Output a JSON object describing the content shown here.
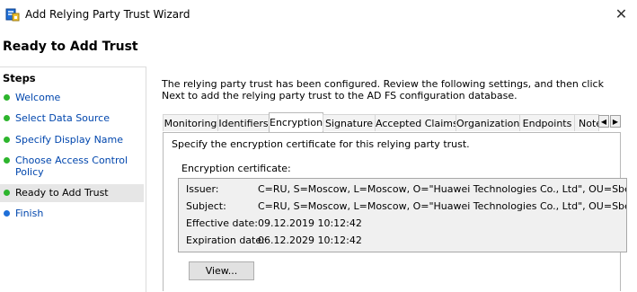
{
  "window": {
    "title": "Add Relying Party Trust Wizard",
    "close_glyph": "✕"
  },
  "page_title": "Ready to Add Trust",
  "steps": {
    "heading": "Steps",
    "items": [
      {
        "label": "Welcome",
        "status": "complete"
      },
      {
        "label": "Select Data Source",
        "status": "complete"
      },
      {
        "label": "Specify Display Name",
        "status": "complete"
      },
      {
        "label": "Choose Access Control\nPolicy",
        "status": "complete"
      },
      {
        "label": "Ready to Add Trust",
        "status": "current"
      },
      {
        "label": "Finish",
        "status": "pending"
      }
    ]
  },
  "main": {
    "description": "The relying party trust has been configured. Review the following settings, and then click Next to add the relying party trust to the AD FS configuration database."
  },
  "tabs": [
    {
      "label": "Monitoring"
    },
    {
      "label": "Identifiers"
    },
    {
      "label": "Encryption",
      "active": true
    },
    {
      "label": "Signature"
    },
    {
      "label": "Accepted Claims"
    },
    {
      "label": "Organization"
    },
    {
      "label": "Endpoints"
    },
    {
      "label": "Note"
    }
  ],
  "tab_scroll": {
    "left": "◀",
    "right": "▶"
  },
  "encryption": {
    "description": "Specify the encryption certificate for this relying party trust.",
    "cert_label": "Encryption certificate:",
    "fields": [
      {
        "key": "Issuer:",
        "value": "C=RU, S=Moscow, L=Moscow, O=\"Huawei Technologies Co., Ltd\", OU=SberCloud"
      },
      {
        "key": "Subject:",
        "value": "C=RU, S=Moscow, L=Moscow, O=\"Huawei Technologies Co., Ltd\", OU=SberCloud"
      },
      {
        "key": "Effective date:",
        "value": "09.12.2019 10:12:42"
      },
      {
        "key": "Expiration date:",
        "value": "06.12.2029 10:12:42"
      }
    ],
    "view_button": "View..."
  },
  "colors": {
    "complete": "#2db52d",
    "current": "#2db52d",
    "pending": "#1f6fd8",
    "link": "#0046ad"
  }
}
